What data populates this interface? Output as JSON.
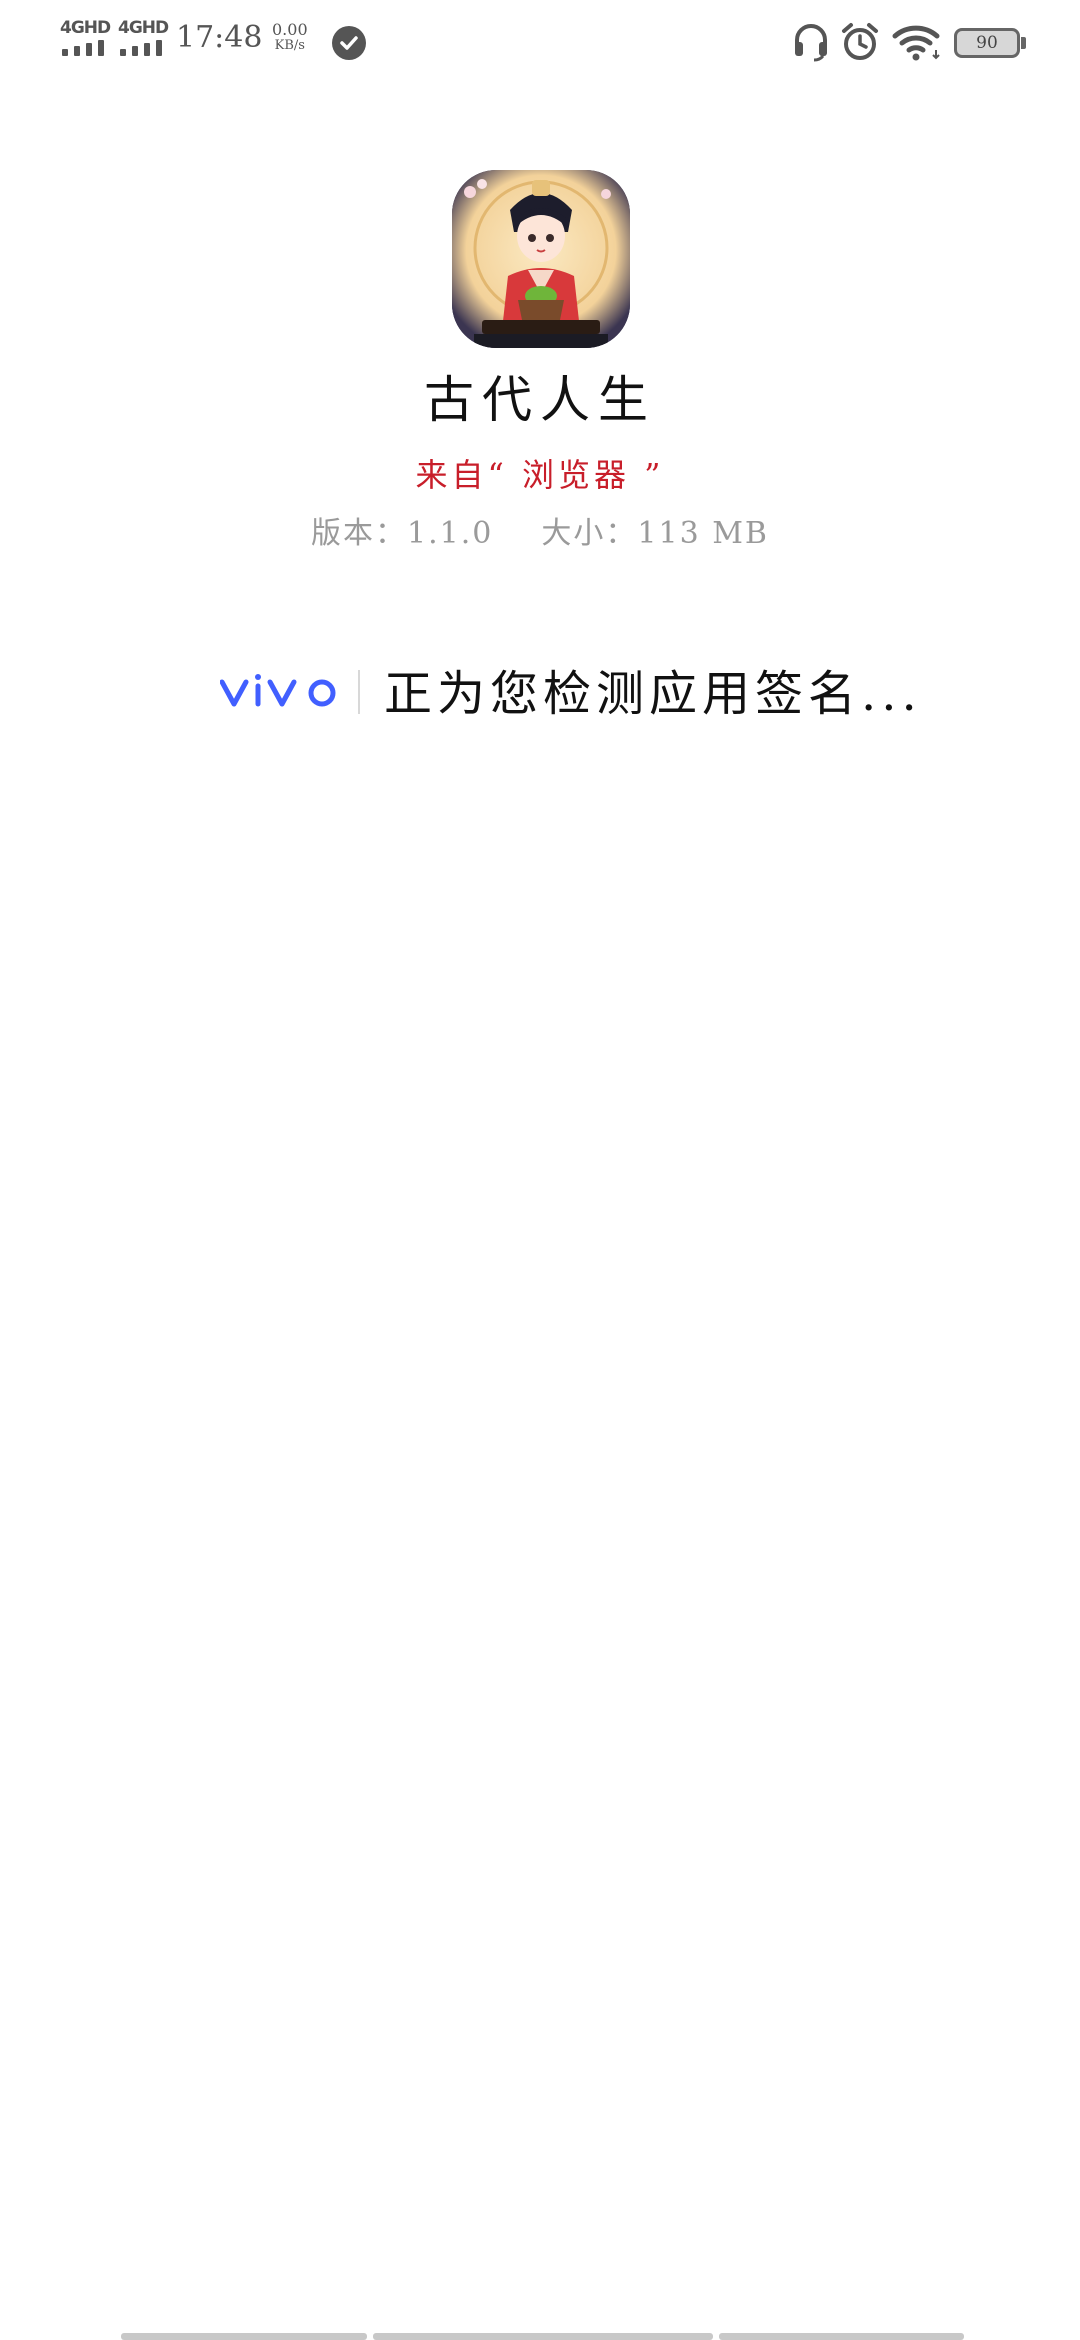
{
  "status_bar": {
    "sim1": "4GHD",
    "sim2": "4GHD",
    "time": "17:48",
    "speed_value": "0.00",
    "speed_unit": "KB/s",
    "battery": "90",
    "icons": [
      "check-circle-icon",
      "headset-icon",
      "alarm-icon",
      "wifi-icon",
      "battery-icon"
    ]
  },
  "app": {
    "name": "古代人生",
    "source": "来自“ 浏览器 ”",
    "version_label": "版本：",
    "version": "1.1.0",
    "size_label": "大小：",
    "size": "113 MB"
  },
  "verify": {
    "brand": "vivo",
    "message": "正为您检测应用签名..."
  },
  "colors": {
    "source_red": "#c81e2a",
    "brand_blue": "#415fff",
    "meta_gray": "#9a9a9a"
  }
}
